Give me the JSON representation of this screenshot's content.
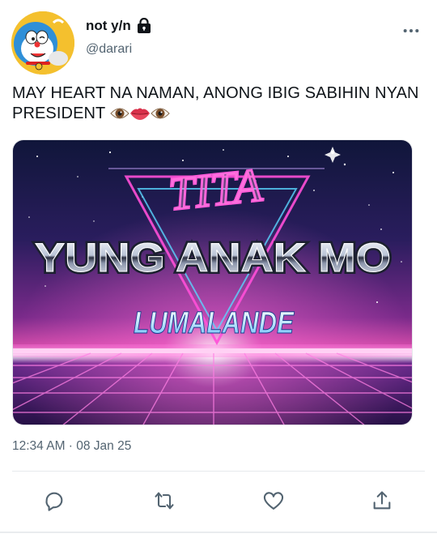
{
  "tweet": {
    "display_name": "not y/n",
    "handle": "@darari",
    "text": "MAY HEART NA NAMAN, ANONG IBIG SABIHIN NYAN PRESIDENT",
    "emojis": [
      "eye-emoji",
      "lips-emoji",
      "eye-emoji"
    ],
    "timestamp": "12:34 AM · 08 Jan 25"
  },
  "media": {
    "line1": "TITA",
    "line2": "YUNG ANAK MO",
    "line3": "LUMALANDE"
  },
  "icons": {
    "lock": "lock-icon",
    "more": "more-dots-icon",
    "reply": "reply-icon",
    "retweet": "retweet-icon",
    "like": "heart-icon",
    "share": "share-icon"
  },
  "colors": {
    "text_primary": "#0f1419",
    "text_secondary": "#536471",
    "icon": "#536471",
    "divider": "#e7eaec"
  }
}
